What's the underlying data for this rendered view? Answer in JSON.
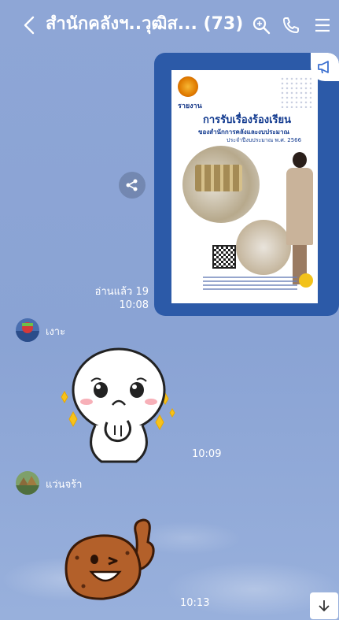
{
  "header": {
    "title": "สำนักคลังฯ..วุฒิส... (73)",
    "icons": [
      "back-icon",
      "search-icon",
      "phone-icon",
      "menu-icon"
    ]
  },
  "messages": [
    {
      "type": "image",
      "doc_text": {
        "label": "รายงาน",
        "title": "การรับเรื่องร้องเรียน",
        "subtitle": "ของสำนักการคลังและงบประมาณ",
        "year": "ประจำปีงบประมาณ พ.ศ. 2566"
      },
      "read": "อ่านแล้ว 19",
      "time": "10:08"
    },
    {
      "type": "sticker",
      "sender": "เงาะ",
      "sticker": "moon-cute-sticker",
      "time": "10:09"
    },
    {
      "type": "sticker",
      "sender": "แว่นจร้า",
      "sticker": "shooky-thumbs-up-sticker",
      "time": "10:13"
    }
  ],
  "colors": {
    "background": "#8ea6d6",
    "header_text": "#ffffff",
    "image_frame": "#2c5aa8"
  }
}
